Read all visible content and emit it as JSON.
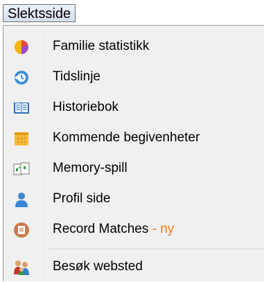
{
  "menu": {
    "title": "Slektsside"
  },
  "items": [
    {
      "label": "Familie statistikk",
      "icon": "pie-chart-icon"
    },
    {
      "label": "Tidslinje",
      "icon": "timeline-clock-icon"
    },
    {
      "label": "Historiebok",
      "icon": "book-icon"
    },
    {
      "label": "Kommende begivenheter",
      "icon": "calendar-icon"
    },
    {
      "label": "Memory-spill",
      "icon": "memory-cards-icon"
    },
    {
      "label": "Profil side",
      "icon": "person-icon"
    },
    {
      "label": "Record Matches",
      "badge": " - ny",
      "icon": "record-matches-icon"
    },
    {
      "label": "Besøk websted",
      "icon": "family-website-icon"
    }
  ],
  "colors": {
    "badge": "#f07b1a",
    "menu_background": "#f0f0f0"
  }
}
